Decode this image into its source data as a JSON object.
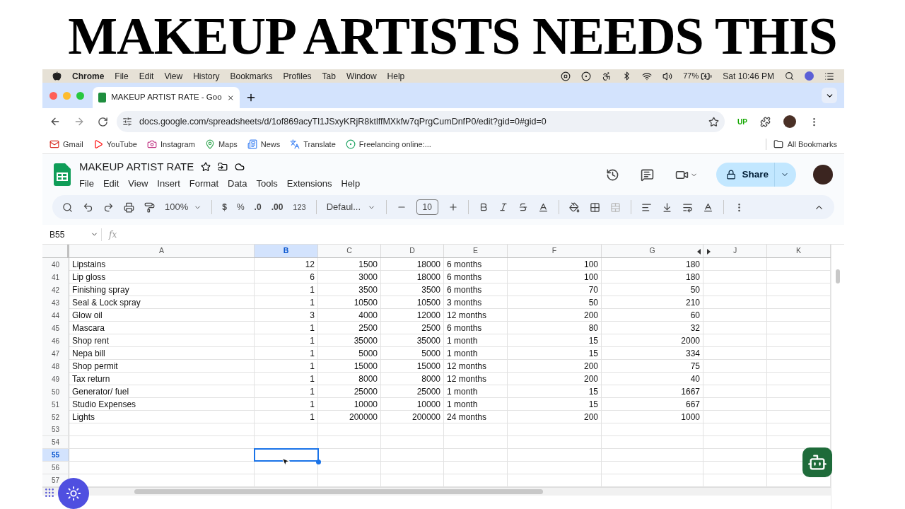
{
  "headline": "MAKEUP ARTISTS NEEDS THIS",
  "menu_bar": {
    "app": "Chrome",
    "items": [
      "File",
      "Edit",
      "View",
      "History",
      "Bookmarks",
      "Profiles",
      "Tab",
      "Window",
      "Help"
    ],
    "battery": "77%",
    "clock": "Sat 10:46 PM"
  },
  "browser": {
    "tab": {
      "title": "MAKEUP ARTIST RATE - Goo",
      "selected": true
    },
    "url": "docs.google.com/spreadsheets/d/1of869acyTl1JSxyKRjR8ktlffMXkfw7qPrgCumDnfP0/edit?gid=0#gid=0",
    "extension": "UP",
    "bookmarks": [
      {
        "label": "Gmail",
        "kind": "mail"
      },
      {
        "label": "YouTube",
        "kind": "video"
      },
      {
        "label": "Instagram",
        "kind": "camera"
      },
      {
        "label": "Maps",
        "kind": "map"
      },
      {
        "label": "News",
        "kind": "news"
      },
      {
        "label": "Translate",
        "kind": "translate"
      },
      {
        "label": "Freelancing online:...",
        "kind": "site"
      }
    ],
    "all_bookmarks": "All Bookmarks"
  },
  "sheet": {
    "title": "MAKEUP ARTIST RATE",
    "menus": [
      "File",
      "Edit",
      "View",
      "Insert",
      "Format",
      "Data",
      "Tools",
      "Extensions",
      "Help"
    ],
    "share": "Share",
    "toolbar": {
      "zoom": "100%",
      "currency": "$",
      "percent": "%",
      "decimal_decrease": ".0",
      "decimal_increase": ".00",
      "number_format": "123",
      "font": "Defaul...",
      "font_size": "10"
    },
    "name_box": "B55",
    "fx": "fx"
  },
  "grid": {
    "columns": [
      {
        "label": "A",
        "kind": "text",
        "selected": false
      },
      {
        "label": "B",
        "kind": "number",
        "selected": true
      },
      {
        "label": "C",
        "kind": "number",
        "selected": false
      },
      {
        "label": "D",
        "kind": "number",
        "selected": false
      },
      {
        "label": "E",
        "kind": "text",
        "selected": false
      },
      {
        "label": "F",
        "kind": "number",
        "selected": false
      },
      {
        "label": "G",
        "kind": "number",
        "selected": false
      },
      {
        "label": "J",
        "kind": "text",
        "selected": false
      },
      {
        "label": "K",
        "kind": "text",
        "selected": false
      }
    ],
    "rows": [
      {
        "number": "40",
        "selected": false,
        "cells": [
          "Lipstains",
          "12",
          "1500",
          "18000",
          "6 months",
          "100",
          "180"
        ]
      },
      {
        "number": "41",
        "selected": false,
        "cells": [
          "Lip gloss",
          "6",
          "3000",
          "18000",
          "6 months",
          "100",
          "180"
        ]
      },
      {
        "number": "42",
        "selected": false,
        "cells": [
          "Finishing spray",
          "1",
          "3500",
          "3500",
          "6 months",
          "70",
          "50"
        ]
      },
      {
        "number": "43",
        "selected": false,
        "cells": [
          "Seal & Lock spray",
          "1",
          "10500",
          "10500",
          "3 months",
          "50",
          "210"
        ]
      },
      {
        "number": "44",
        "selected": false,
        "cells": [
          "Glow oil",
          "3",
          "4000",
          "12000",
          "12 months",
          "200",
          "60"
        ]
      },
      {
        "number": "45",
        "selected": false,
        "cells": [
          "Mascara",
          "1",
          "2500",
          "2500",
          "6 months",
          "80",
          "32"
        ]
      },
      {
        "number": "46",
        "selected": false,
        "cells": [
          "Shop rent",
          "1",
          "35000",
          "35000",
          "1 month",
          "15",
          "2000"
        ]
      },
      {
        "number": "47",
        "selected": false,
        "cells": [
          "Nepa bill",
          "1",
          "5000",
          "5000",
          "1 month",
          "15",
          "334"
        ]
      },
      {
        "number": "48",
        "selected": false,
        "cells": [
          "Shop permit",
          "1",
          "15000",
          "15000",
          "12 months",
          "200",
          "75"
        ]
      },
      {
        "number": "49",
        "selected": false,
        "cells": [
          "Tax return",
          "1",
          "8000",
          "8000",
          "12 months",
          "200",
          "40"
        ]
      },
      {
        "number": "50",
        "selected": false,
        "cells": [
          "Generator/ fuel",
          "1",
          "25000",
          "25000",
          "1 month",
          "15",
          "1667"
        ]
      },
      {
        "number": "51",
        "selected": false,
        "cells": [
          "Studio Expenses",
          "1",
          "10000",
          "10000",
          "1 month",
          "15",
          "667"
        ]
      },
      {
        "number": "52",
        "selected": false,
        "cells": [
          "Lights",
          "1",
          "200000",
          "200000",
          "24 months",
          "200",
          "1000"
        ]
      },
      {
        "number": "53",
        "selected": false
      },
      {
        "number": "54",
        "selected": false
      },
      {
        "number": "55",
        "selected": true
      },
      {
        "number": "56",
        "selected": false
      },
      {
        "number": "57",
        "selected": false
      }
    ]
  }
}
